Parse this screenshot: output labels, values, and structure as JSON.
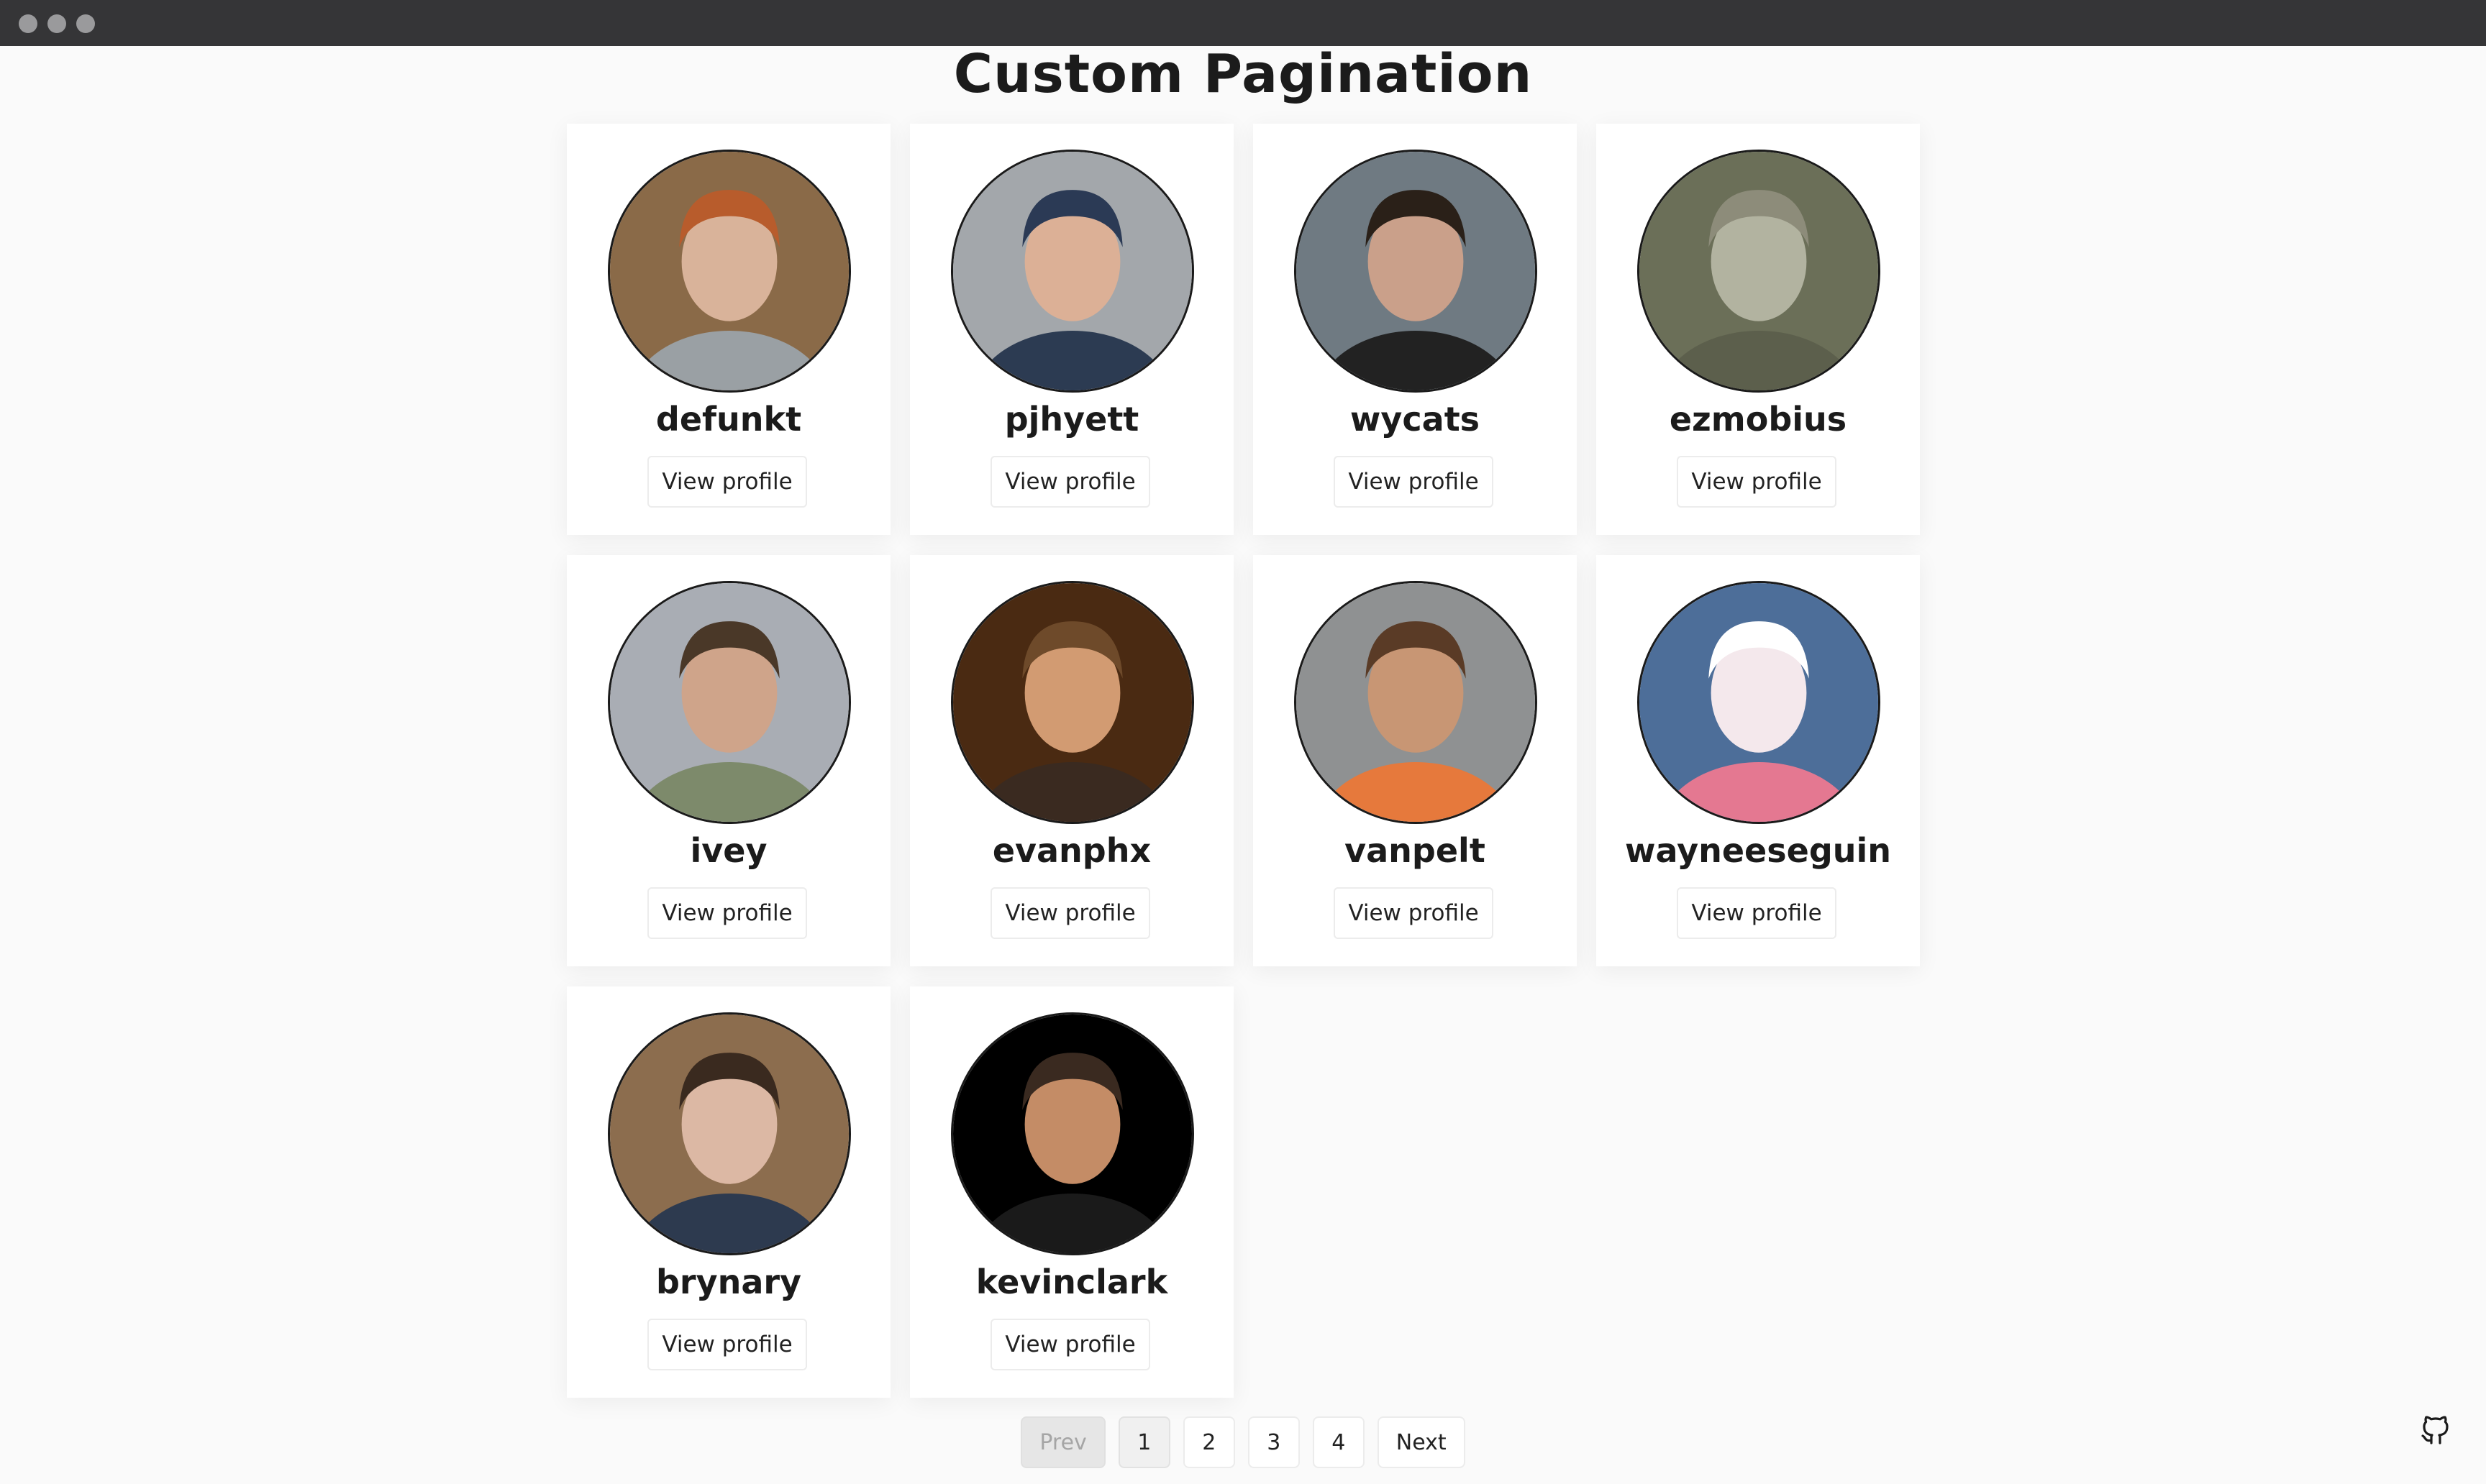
{
  "page": {
    "title": "Custom Pagination"
  },
  "users": [
    {
      "name": "defunkt",
      "action": "View profile",
      "avatar": "defunkt-avatar",
      "colors": {
        "bg": "#8a6a48",
        "hair": "#b85c2c",
        "skin": "#d9b39a",
        "shirt": "#9aa0a4"
      }
    },
    {
      "name": "pjhyett",
      "action": "View profile",
      "avatar": "pjhyett-avatar",
      "colors": {
        "bg": "#a3a7ab",
        "hair": "#2b3a55",
        "skin": "#dcb096",
        "shirt": "#2c3b52"
      }
    },
    {
      "name": "wycats",
      "action": "View profile",
      "avatar": "wycats-avatar",
      "colors": {
        "bg": "#6f7a82",
        "hair": "#2a2018",
        "skin": "#caa08a",
        "shirt": "#222222"
      }
    },
    {
      "name": "ezmobius",
      "action": "View profile",
      "avatar": "ezmobius-avatar",
      "colors": {
        "bg": "#6b6f58",
        "hair": "#8d8c7a",
        "skin": "#b2b3a0",
        "shirt": "#5c5f4c"
      }
    },
    {
      "name": "ivey",
      "action": "View profile",
      "avatar": "ivey-avatar",
      "colors": {
        "bg": "#a9adb4",
        "hair": "#4a3828",
        "skin": "#cfa48a",
        "shirt": "#7d8a6b"
      }
    },
    {
      "name": "evanphx",
      "action": "View profile",
      "avatar": "evanphx-avatar",
      "colors": {
        "bg": "#4a2a12",
        "hair": "#6e4a2a",
        "skin": "#d29b72",
        "shirt": "#3a2a20"
      }
    },
    {
      "name": "vanpelt",
      "action": "View profile",
      "avatar": "vanpelt-avatar",
      "colors": {
        "bg": "#8f9192",
        "hair": "#5a3b26",
        "skin": "#c89674",
        "shirt": "#e6793c"
      }
    },
    {
      "name": "wayneeseguin",
      "action": "View profile",
      "avatar": "wayneeseguin-avatar",
      "colors": {
        "bg": "#4d6e99",
        "hair": "#ffffff",
        "skin": "#f4e8ec",
        "shirt": "#e47891"
      }
    },
    {
      "name": "brynary",
      "action": "View profile",
      "avatar": "brynary-avatar",
      "colors": {
        "bg": "#8c6d4e",
        "hair": "#3a2a1f",
        "skin": "#dcb8a4",
        "shirt": "#2d3a4f"
      }
    },
    {
      "name": "kevinclark",
      "action": "View profile",
      "avatar": "kevinclark-avatar",
      "colors": {
        "bg": "#000000",
        "hair": "#3a2a20",
        "skin": "#c48c66",
        "shirt": "#1a1a1a"
      }
    }
  ],
  "pagination": {
    "prev": "Prev",
    "pages": [
      "1",
      "2",
      "3",
      "4"
    ],
    "current": "1",
    "next": "Next"
  },
  "icons": {
    "github": "github-icon"
  }
}
